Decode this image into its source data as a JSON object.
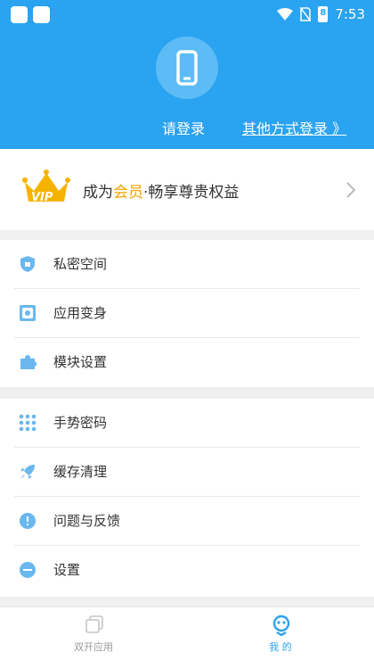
{
  "status_bar": {
    "time": "7:53",
    "battery": "8"
  },
  "header": {
    "login_label": "请登录",
    "other_login_label": "其他方式登录 》"
  },
  "vip": {
    "prefix": "成为",
    "highlight": "会员",
    "suffix": "·畅享尊贵权益",
    "badge": "VIP"
  },
  "menu": {
    "group1": [
      {
        "label": "私密空间",
        "icon": "shield-icon"
      },
      {
        "label": "应用变身",
        "icon": "disguise-icon"
      },
      {
        "label": "模块设置",
        "icon": "puzzle-icon"
      }
    ],
    "group2": [
      {
        "label": "手势密码",
        "icon": "gesture-grid-icon"
      },
      {
        "label": "缓存清理",
        "icon": "rocket-icon"
      },
      {
        "label": "问题与反馈",
        "icon": "feedback-icon"
      },
      {
        "label": "设置",
        "icon": "settings-icon"
      }
    ]
  },
  "tabs": [
    {
      "label": "双开应用",
      "icon": "dual-app-icon",
      "active": false
    },
    {
      "label": "我 的",
      "icon": "profile-icon",
      "active": true
    }
  ],
  "colors": {
    "header": "#2aa3f0",
    "accent": "#2aa3f0",
    "vip_gold": "#f3a300",
    "icon_blue": "#6ab8ee"
  }
}
